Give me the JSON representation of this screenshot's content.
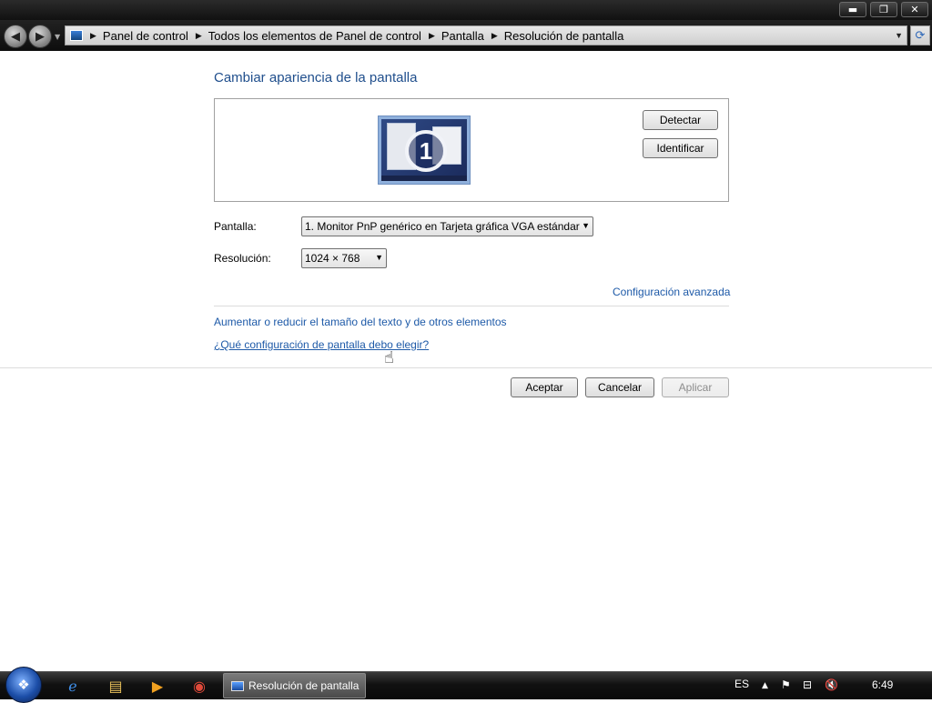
{
  "window": {
    "minimize": "▬",
    "restore": "❐",
    "close": "✕"
  },
  "address_bar": {
    "crumbs": [
      "Panel de control",
      "Todos los elementos de Panel de control",
      "Pantalla",
      "Resolución de pantalla"
    ]
  },
  "main": {
    "heading": "Cambiar apariencia de la pantalla",
    "monitor_number": "1",
    "detect_button": "Detectar",
    "identify_button": "Identificar",
    "display_label": "Pantalla:",
    "display_value": "1. Monitor PnP genérico en Tarjeta gráfica VGA estándar",
    "resolution_label": "Resolución:",
    "resolution_value": "1024 × 768",
    "advanced_link": "Configuración avanzada",
    "text_size_link": "Aumentar o reducir el tamaño del texto y de otros elementos",
    "help_link": "¿Qué configuración de pantalla debo elegir?"
  },
  "footer_buttons": {
    "ok": "Aceptar",
    "cancel": "Cancelar",
    "apply": "Aplicar"
  },
  "taskbar": {
    "active_task": "Resolución de pantalla",
    "language": "ES",
    "clock": "6:49"
  },
  "colors": {
    "link": "#1e5aa8",
    "heading": "#1f4e8c"
  }
}
